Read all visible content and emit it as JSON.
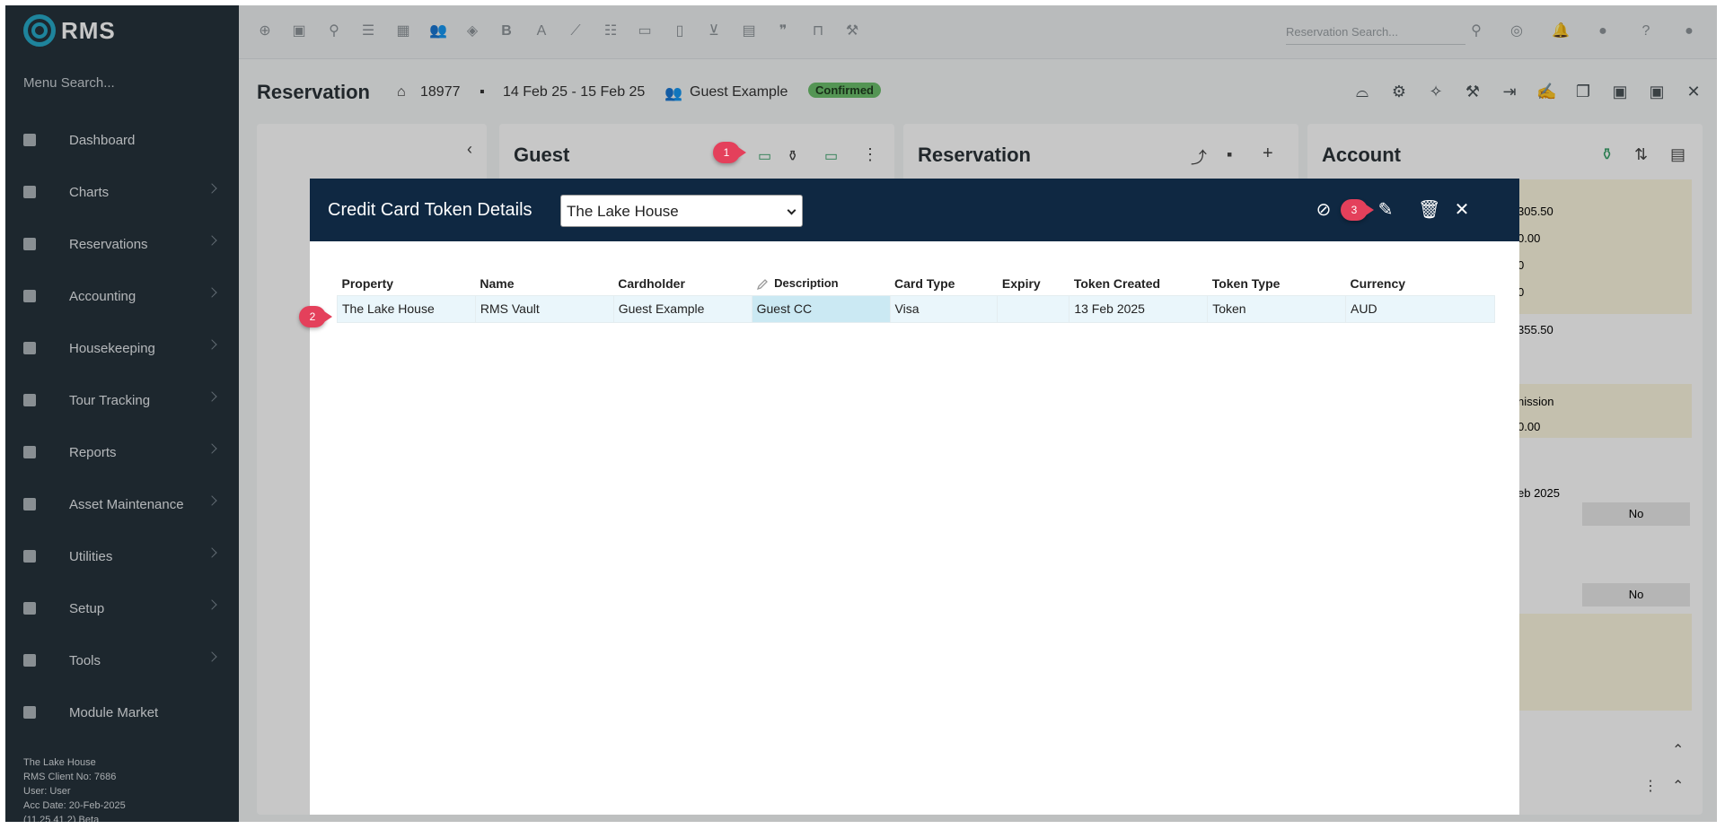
{
  "app": {
    "logo_text": "RMS",
    "menu_search": "Menu Search..."
  },
  "sidebar": {
    "items": [
      {
        "label": "Dashboard",
        "has_chevron": false
      },
      {
        "label": "Charts",
        "has_chevron": true
      },
      {
        "label": "Reservations",
        "has_chevron": true
      },
      {
        "label": "Accounting",
        "has_chevron": true
      },
      {
        "label": "Housekeeping",
        "has_chevron": true
      },
      {
        "label": "Tour Tracking",
        "has_chevron": true
      },
      {
        "label": "Reports",
        "has_chevron": true
      },
      {
        "label": "Asset Maintenance",
        "has_chevron": true
      },
      {
        "label": "Utilities",
        "has_chevron": true
      },
      {
        "label": "Setup",
        "has_chevron": true
      },
      {
        "label": "Tools",
        "has_chevron": true
      },
      {
        "label": "Module Market",
        "has_chevron": false
      }
    ],
    "footer": {
      "property": "The Lake House",
      "client": "RMS Client No: 7686",
      "user": "User: User",
      "acc_date": "Acc Date: 20-Feb-2025",
      "version": "(11.25.41.2) Beta"
    }
  },
  "topbar": {
    "reservation_search_placeholder": "Reservation Search..."
  },
  "reservation": {
    "title": "Reservation",
    "number": "18977",
    "dates": "14 Feb 25  -  15 Feb 25",
    "guest": "Guest Example",
    "status": "Confirmed"
  },
  "panels": {
    "guest": "Guest",
    "reservation": "Reservation",
    "account": "Account"
  },
  "modal": {
    "title": "Credit Card Token Details",
    "selected_property": "The Lake House",
    "columns": [
      "Property",
      "Name",
      "Cardholder",
      "Description",
      "Card Type",
      "Expiry",
      "Token Created",
      "Token Type",
      "Currency"
    ],
    "rows": [
      [
        "The Lake House",
        "RMS Vault",
        "Guest Example",
        "Guest CC",
        "Visa",
        "",
        "13 Feb 2025",
        "Token",
        "AUD"
      ]
    ]
  },
  "callouts": [
    "1",
    "2",
    "3"
  ],
  "background_account": {
    "values": [
      "305.50",
      "0.00",
      "0",
      "0",
      "355.50"
    ],
    "commission": "nission",
    "commission_value": "0.00",
    "date_fragment": "eb 2025",
    "no_1": "No",
    "no_2": "No"
  },
  "colors": {
    "sidebar": "#26323b",
    "modal_header": "#0f2842",
    "accent": "#27a9c8",
    "callout": "#e4405b",
    "badge": "#6cbf6c"
  }
}
